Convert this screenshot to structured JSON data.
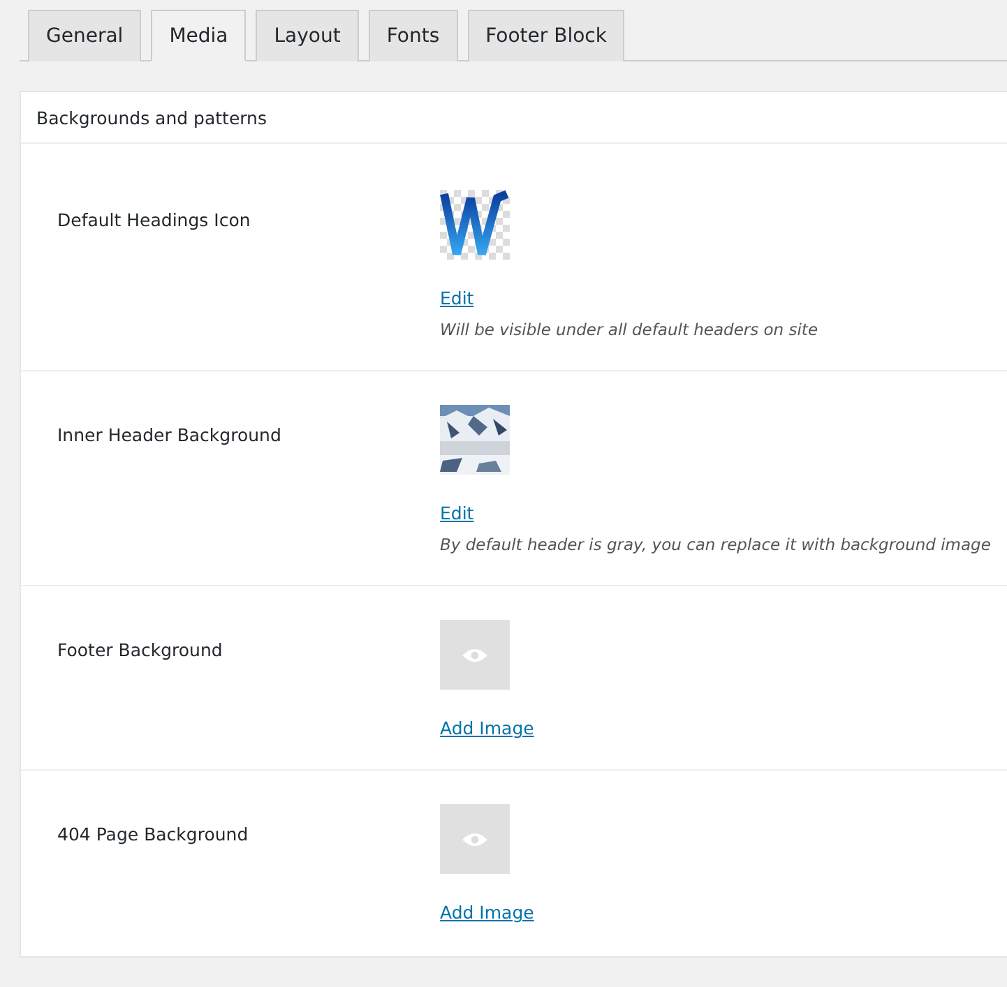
{
  "tabs": [
    {
      "label": "General",
      "selected": false
    },
    {
      "label": "Media",
      "selected": true
    },
    {
      "label": "Layout",
      "selected": false
    },
    {
      "label": "Fonts",
      "selected": false
    },
    {
      "label": "Footer Block",
      "selected": false
    }
  ],
  "section": {
    "title": "Backgrounds and patterns"
  },
  "rows": [
    {
      "label": "Default Headings Icon",
      "kind": "icon",
      "link": "Edit",
      "description": "Will be visible under all default headers on site"
    },
    {
      "label": "Inner Header Background",
      "kind": "picture",
      "link": "Edit",
      "description": "By default header is gray, you can replace it with background image"
    },
    {
      "label": "Footer Background",
      "kind": "empty",
      "link": "Add Image"
    },
    {
      "label": "404 Page Background",
      "kind": "empty",
      "link": "Add Image"
    }
  ]
}
